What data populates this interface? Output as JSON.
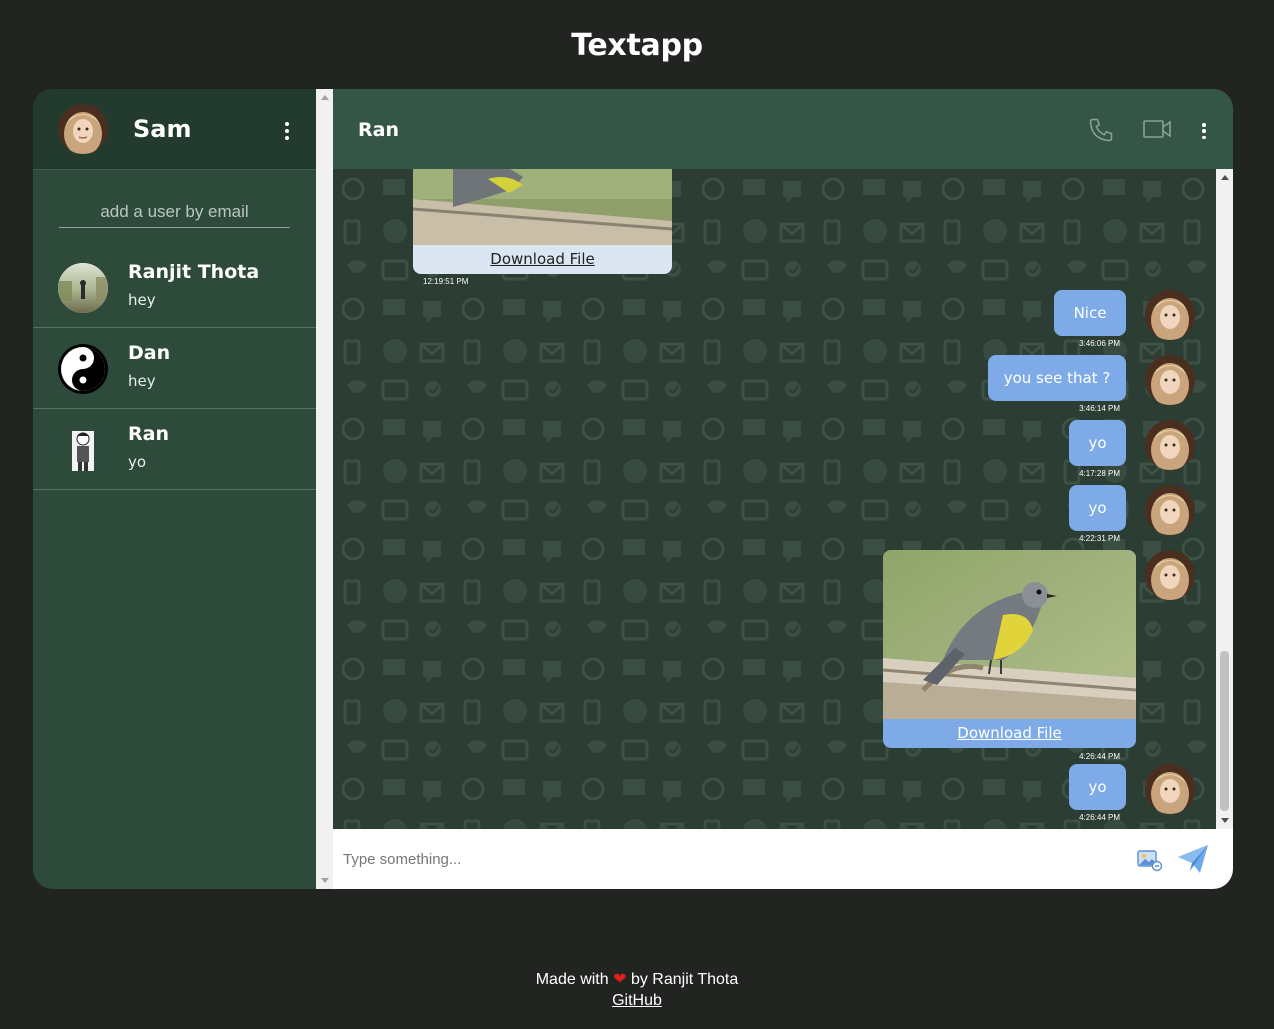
{
  "app": {
    "title": "Textapp"
  },
  "sidebar": {
    "user": {
      "name": "Sam"
    },
    "add_user_placeholder": "add a user by email",
    "chats": [
      {
        "name": "Ranjit Thota",
        "last_message": "hey"
      },
      {
        "name": "Dan",
        "last_message": "hey"
      },
      {
        "name": "Ran",
        "last_message": "yo"
      }
    ]
  },
  "chat": {
    "contact_name": "Ran",
    "messages": [
      {
        "type": "file",
        "link_text": "Download File",
        "time": "12:19:51 PM",
        "side": "received"
      },
      {
        "type": "text",
        "text": "Nice",
        "time": "3:46:06 PM",
        "side": "sent"
      },
      {
        "type": "text",
        "text": "you see that ?",
        "time": "3:46:14 PM",
        "side": "sent"
      },
      {
        "type": "text",
        "text": "yo",
        "time": "4:17:28 PM",
        "side": "sent"
      },
      {
        "type": "text",
        "text": "yo",
        "time": "4:22:31 PM",
        "side": "sent"
      },
      {
        "type": "file",
        "link_text": "Download File",
        "time": "4:26:44 PM",
        "side": "sent"
      },
      {
        "type": "text",
        "text": "yo",
        "time": "4:26:44 PM",
        "side": "sent"
      }
    ],
    "composer_placeholder": "Type something..."
  },
  "footer": {
    "made_with": "Made with",
    "by": "by Ranjit Thota",
    "link": "GitHub"
  },
  "colors": {
    "page_bg": "#222421",
    "sidebar_bg": "#2d4a3b",
    "header_bg": "#355546",
    "bubble_sent": "#7eabe8",
    "bubble_received": "#dce6f3"
  },
  "icons": [
    "kebab-menu-icon",
    "phone-icon",
    "video-icon",
    "attach-image-icon",
    "send-icon",
    "heart-icon"
  ]
}
